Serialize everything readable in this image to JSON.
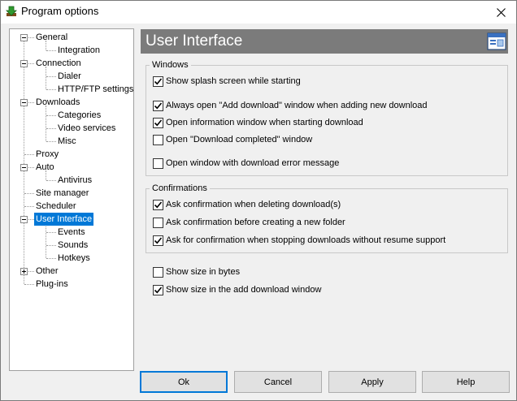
{
  "window": {
    "title": "Program options",
    "app_icon": "download-arrow-icon",
    "close_icon": "close-icon"
  },
  "tree": [
    {
      "label": "General",
      "level": 0,
      "expander": "minus"
    },
    {
      "label": "Integration",
      "level": 1
    },
    {
      "label": "Connection",
      "level": 0,
      "expander": "minus"
    },
    {
      "label": "Dialer",
      "level": 1
    },
    {
      "label": "HTTP/FTP settings",
      "level": 1
    },
    {
      "label": "Downloads",
      "level": 0,
      "expander": "minus"
    },
    {
      "label": "Categories",
      "level": 1
    },
    {
      "label": "Video services",
      "level": 1
    },
    {
      "label": "Misc",
      "level": 1
    },
    {
      "label": "Proxy",
      "level": 0
    },
    {
      "label": "Auto",
      "level": 0,
      "expander": "minus"
    },
    {
      "label": "Antivirus",
      "level": 1
    },
    {
      "label": "Site manager",
      "level": 0
    },
    {
      "label": "Scheduler",
      "level": 0
    },
    {
      "label": "User Interface",
      "level": 0,
      "expander": "minus",
      "selected": true
    },
    {
      "label": "Events",
      "level": 1
    },
    {
      "label": "Sounds",
      "level": 1
    },
    {
      "label": "Hotkeys",
      "level": 1
    },
    {
      "label": "Other",
      "level": 0,
      "expander": "plus"
    },
    {
      "label": "Plug-ins",
      "level": 0
    }
  ],
  "panel": {
    "title": "User Interface",
    "header_icon": "window-settings-icon",
    "windows_group": {
      "label": "Windows",
      "options": [
        {
          "label": "Show splash screen while starting",
          "checked": true
        },
        {
          "label": "Always open \"Add download\" window when adding new download",
          "checked": true
        },
        {
          "label": "Open information window when starting download",
          "checked": true
        },
        {
          "label": "Open \"Download completed\" window",
          "checked": false
        },
        {
          "label": "Open window with download error message",
          "checked": false
        }
      ]
    },
    "confirmations_group": {
      "label": "Confirmations",
      "options": [
        {
          "label": "Ask confirmation when deleting download(s)",
          "checked": true
        },
        {
          "label": "Ask confirmation before creating a new folder",
          "checked": false
        },
        {
          "label": "Ask for confirmation when stopping downloads without resume support",
          "checked": true
        }
      ]
    },
    "standalone_options": [
      {
        "label": "Show size in bytes",
        "checked": false
      },
      {
        "label": "Show size in the add download window",
        "checked": true
      }
    ]
  },
  "buttons": {
    "ok": "Ok",
    "cancel": "Cancel",
    "apply": "Apply",
    "help": "Help"
  },
  "colors": {
    "selection": "#0078d7",
    "header_bg": "#7b7b7b",
    "window_bg": "#f0f0f0"
  }
}
